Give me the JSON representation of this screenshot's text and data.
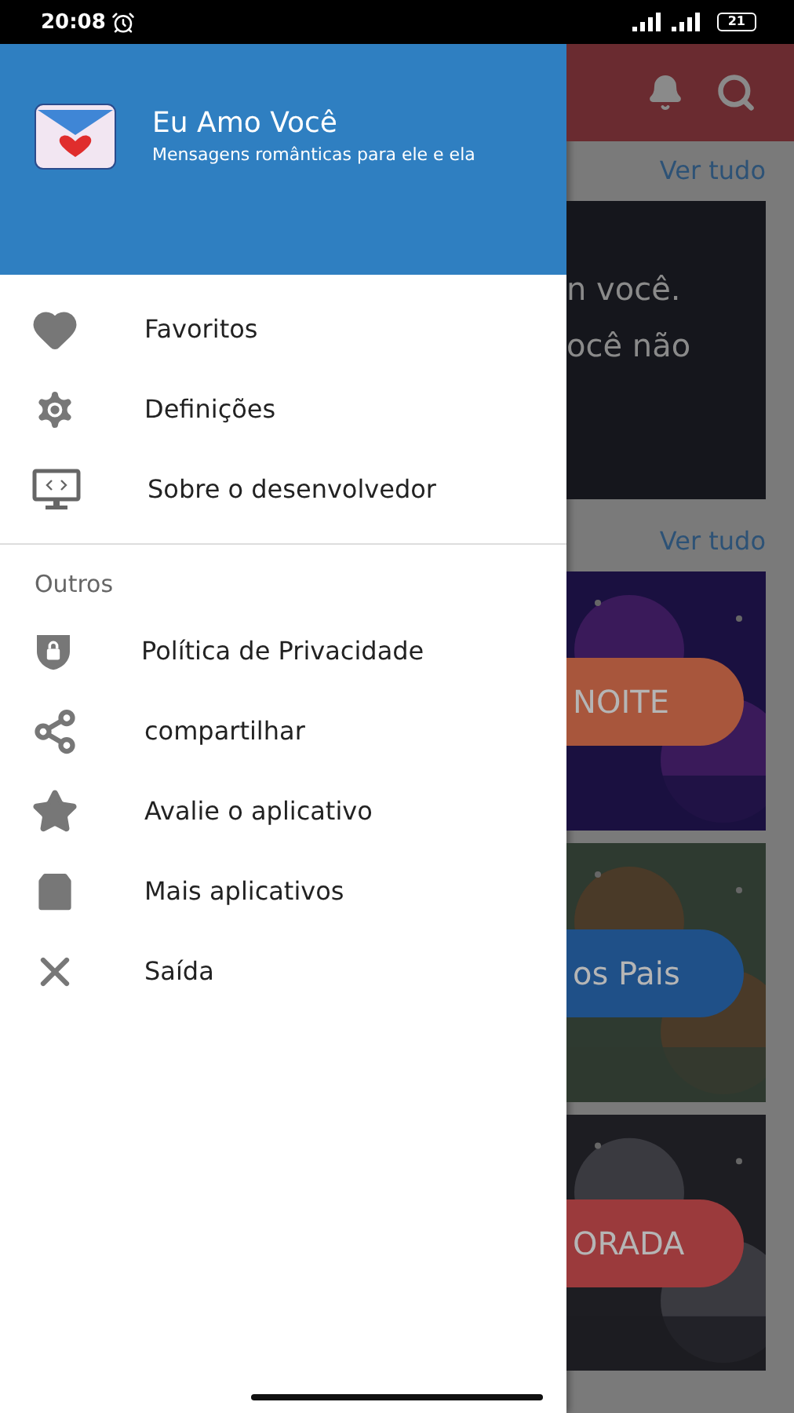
{
  "status_bar": {
    "time": "20:08",
    "battery": "21"
  },
  "drawer": {
    "header": {
      "title": "Eu Amo Você",
      "subtitle": "Mensagens românticas para ele e ela"
    },
    "items": [
      {
        "label": "Favoritos"
      },
      {
        "label": "Definições"
      },
      {
        "label": "Sobre o desenvolvedor"
      }
    ],
    "section": {
      "title": "Outros",
      "items": [
        {
          "label": "Política de Privacidade"
        },
        {
          "label": "compartilhar"
        },
        {
          "label": "Avalie o aplicativo"
        },
        {
          "label": "Mais aplicativos"
        },
        {
          "label": "Saída"
        }
      ]
    }
  },
  "background": {
    "sections": [
      {
        "link": "Ver tudo",
        "cards": [
          {
            "kind": "quote",
            "lines": [
              "n você.",
              "ocê não"
            ]
          }
        ]
      },
      {
        "link": "Ver tudo",
        "cards": [
          {
            "kind": "banner",
            "button": "NOITE",
            "color": "#a8563c"
          },
          {
            "kind": "banner",
            "button": "os Pais",
            "color": "#1f5088"
          },
          {
            "kind": "banner",
            "button": "ORADA",
            "color": "#9b3a3c"
          }
        ]
      }
    ]
  }
}
